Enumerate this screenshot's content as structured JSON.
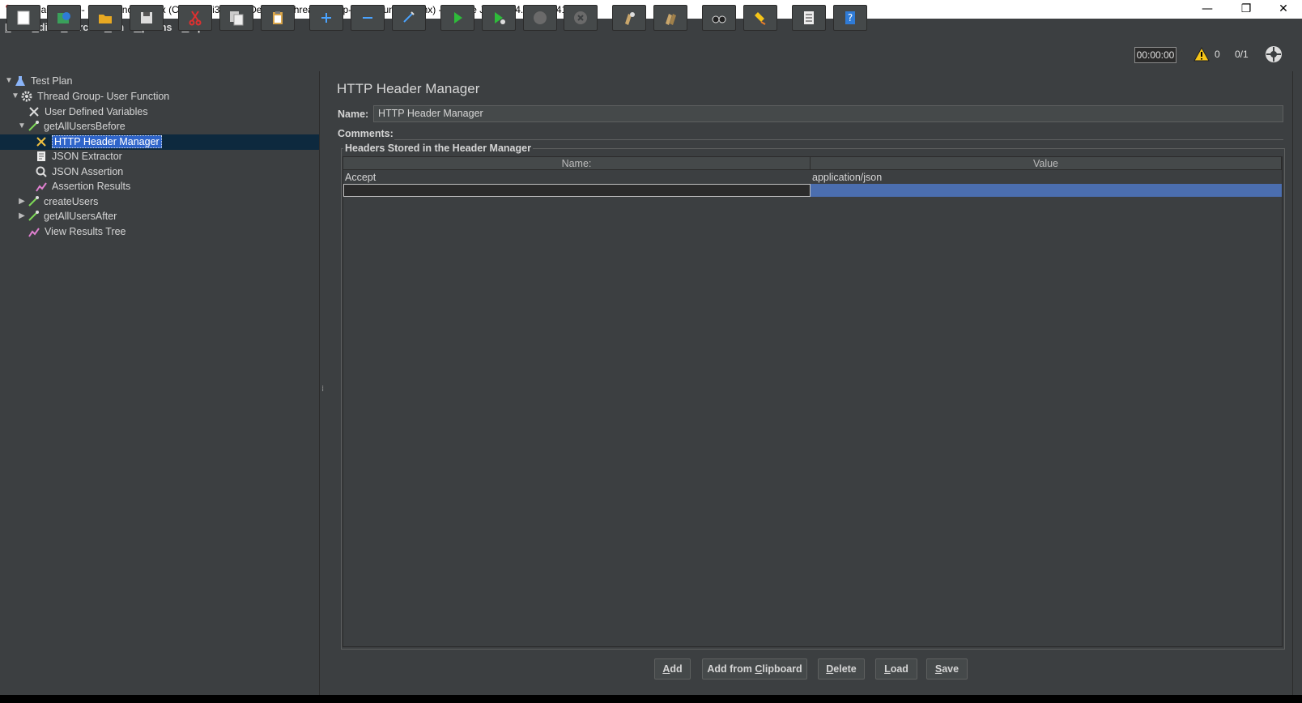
{
  "window": {
    "title": "Thread Group- User Function.jmx (C:\\Users\\i348910\\Desktop\\Thread Group- User Function.jmx) - Apache JMeter (4.0 r1823414)",
    "minimize": "—",
    "restore": "❐",
    "close": "✕"
  },
  "menu": {
    "file": {
      "mn": "F",
      "rest": "ile"
    },
    "edit": {
      "mn": "E",
      "rest": "dit"
    },
    "search": {
      "mn": "S",
      "rest": "earch"
    },
    "run": {
      "mn": "R",
      "rest": "un"
    },
    "options": {
      "mn": "O",
      "rest": "ptions"
    },
    "help": {
      "mn": "H",
      "rest": "elp"
    }
  },
  "toolbar": {
    "timer": "00:00:00",
    "warning_count": "0",
    "threads": "0/1"
  },
  "tree": {
    "items": [
      {
        "label": "Test Plan"
      },
      {
        "label": "Thread Group- User Function"
      },
      {
        "label": "User Defined Variables"
      },
      {
        "label": "getAllUsersBefore"
      },
      {
        "label": "HTTP Header Manager"
      },
      {
        "label": "JSON Extractor"
      },
      {
        "label": "JSON Assertion"
      },
      {
        "label": "Assertion Results"
      },
      {
        "label": "createUsers"
      },
      {
        "label": "getAllUsersAfter"
      },
      {
        "label": "View Results Tree"
      }
    ]
  },
  "panel": {
    "title": "HTTP Header Manager",
    "name_label": "Name:",
    "name_value": "HTTP Header Manager",
    "comments_label": "Comments:",
    "group_title": "Headers Stored in the Header Manager",
    "columns": [
      "Name:",
      "Value"
    ],
    "rows": [
      {
        "name": "Accept",
        "value": "application/json"
      },
      {
        "name": "",
        "value": ""
      }
    ]
  },
  "buttons": {
    "add": {
      "mn": "A",
      "rest": "dd"
    },
    "add_clip": {
      "pre": "Add from ",
      "mn": "C",
      "rest": "lipboard"
    },
    "delete": {
      "mn": "D",
      "rest": "elete"
    },
    "load": {
      "mn": "L",
      "rest": "oad"
    },
    "save": {
      "mn": "S",
      "rest": "ave"
    }
  }
}
